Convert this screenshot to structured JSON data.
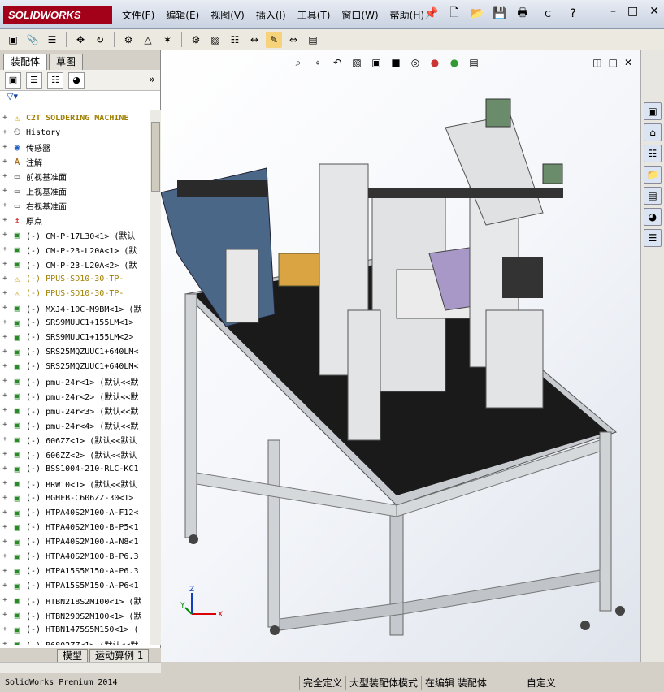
{
  "app": {
    "logo_text": "SOLIDWORKS",
    "brand_color": "#a3001a"
  },
  "menu": [
    "文件(F)",
    "编辑(E)",
    "视图(V)",
    "插入(I)",
    "工具(T)",
    "窗口(W)",
    "帮助(H)"
  ],
  "search_placeholder": "C",
  "left_tabs": [
    "装配体",
    "草图"
  ],
  "tree": {
    "root": "C2T SOLDERING MACHINE",
    "items": [
      {
        "icon": "history-icon",
        "label": "History"
      },
      {
        "icon": "sensor-icon",
        "label": "传感器"
      },
      {
        "icon": "annotation-icon",
        "label": "注解"
      },
      {
        "icon": "plane-icon",
        "label": "前视基准面"
      },
      {
        "icon": "plane-icon",
        "label": "上视基准面"
      },
      {
        "icon": "plane-icon",
        "label": "右视基准面"
      },
      {
        "icon": "origin-icon",
        "label": "原点"
      },
      {
        "icon": "part-icon",
        "label": "(-) CM-P-17L30<1> (默认"
      },
      {
        "icon": "part-icon",
        "label": "(-) CM-P-23-L20A<1> (默"
      },
      {
        "icon": "part-icon",
        "label": "(-) CM-P-23-L20A<2> (默"
      },
      {
        "icon": "warning-icon",
        "label": "(-) PPUS-SD10-30-TP-",
        "warn": true
      },
      {
        "icon": "warning-icon",
        "label": "(-) PPUS-SD10-30-TP-",
        "warn": true
      },
      {
        "icon": "part-icon",
        "label": "(-) MXJ4-10C-M9BM<1> (默"
      },
      {
        "icon": "part-icon",
        "label": "(-) SRS9MUUC1+155LM<1>"
      },
      {
        "icon": "part-icon",
        "label": "(-) SRS9MUUC1+155LM<2>"
      },
      {
        "icon": "part-icon",
        "label": "(-) SRS25MQZUUC1+640LM<"
      },
      {
        "icon": "part-icon",
        "label": "(-) SRS25MQZUUC1+640LM<"
      },
      {
        "icon": "part-icon",
        "label": "(-) pmu-24r<1> (默认<<默"
      },
      {
        "icon": "part-icon",
        "label": "(-) pmu-24r<2> (默认<<默"
      },
      {
        "icon": "part-icon",
        "label": "(-) pmu-24r<3> (默认<<默"
      },
      {
        "icon": "part-icon",
        "label": "(-) pmu-24r<4> (默认<<默"
      },
      {
        "icon": "part-icon",
        "label": "(-) 606ZZ<1> (默认<<默认"
      },
      {
        "icon": "part-icon",
        "label": "(-) 606ZZ<2> (默认<<默认"
      },
      {
        "icon": "part-icon",
        "label": "(-) BSS1004-210-RLC-KC1"
      },
      {
        "icon": "part-icon",
        "label": "(-) BRW10<1> (默认<<默认"
      },
      {
        "icon": "part-icon",
        "label": "(-) BGHFB-C606ZZ-30<1>"
      },
      {
        "icon": "part-icon",
        "label": "(-) HTPA40S2M100-A-F12<"
      },
      {
        "icon": "part-icon",
        "label": "(-) HTPA40S2M100-B-P5<1"
      },
      {
        "icon": "part-icon",
        "label": "(-) HTPA40S2M100-A-N8<1"
      },
      {
        "icon": "part-icon",
        "label": "(-) HTPA40S2M100-B-P6.3"
      },
      {
        "icon": "part-icon",
        "label": "(-) HTPA15S5M150-A-P6.3"
      },
      {
        "icon": "part-icon",
        "label": "(-) HTPA15S5M150-A-P6<1"
      },
      {
        "icon": "part-icon",
        "label": "(-) HTBN218S2M100<1> (默"
      },
      {
        "icon": "part-icon",
        "label": "(-) HTBN290S2M100<1> (默"
      },
      {
        "icon": "part-icon",
        "label": "(-) HTBN1475S5M150<1> ("
      },
      {
        "icon": "part-icon",
        "label": "(-) B6802ZZ<1> (默认<<默"
      }
    ]
  },
  "bottom_tabs": [
    "模型",
    "运动算例 1"
  ],
  "status": {
    "app": "SolidWorks Premium 2014",
    "state1": "完全定义",
    "state2": "大型装配体模式",
    "state3": "在编辑 装配体",
    "state4": "自定义"
  },
  "triad": {
    "x": "X",
    "y": "Y",
    "z": "Z"
  }
}
